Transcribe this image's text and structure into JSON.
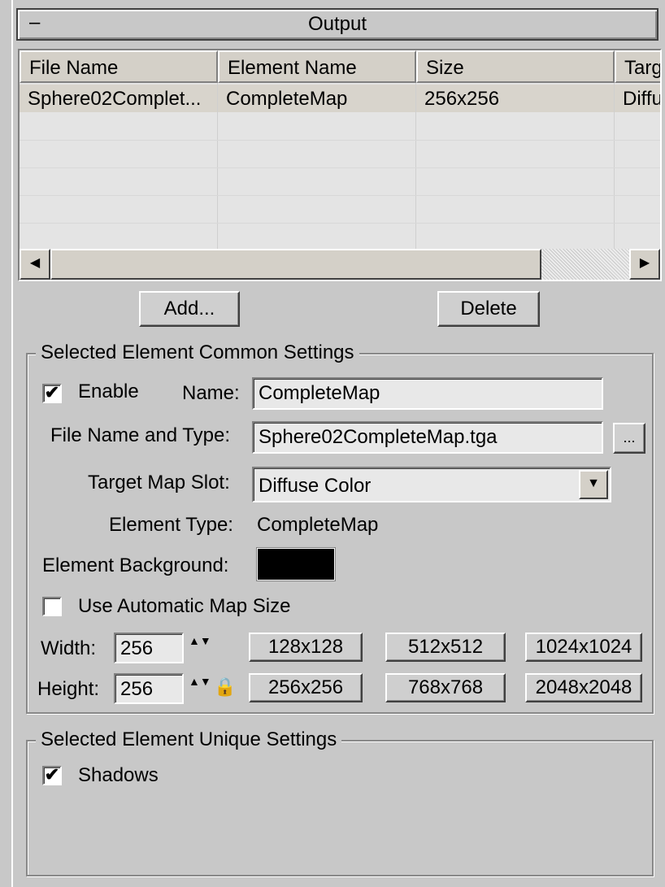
{
  "rollout": {
    "toggle": "–",
    "title": "Output"
  },
  "list": {
    "columns": [
      "File Name",
      "Element Name",
      "Size",
      "Targ"
    ],
    "rows": [
      {
        "file_name": "Sphere02Complet...",
        "element_name": "CompleteMap",
        "size": "256x256",
        "target": "Diffu"
      }
    ],
    "scroll_left": "◀",
    "scroll_right": "▶"
  },
  "buttons": {
    "add": "Add...",
    "delete": "Delete"
  },
  "common": {
    "title": "Selected Element Common Settings",
    "enable_label": "Enable",
    "enable_checked": "✔",
    "name_label": "Name:",
    "name_value": "CompleteMap",
    "file_label": "File Name and Type:",
    "file_value": "Sphere02CompleteMap.tga",
    "browse": "...",
    "slot_label": "Target Map Slot:",
    "slot_value": "Diffuse Color",
    "slot_arrow": "▼",
    "type_label": "Element Type:",
    "type_value": "CompleteMap",
    "bg_label": "Element Background:",
    "bg_color": "#000000",
    "auto_label": "Use Automatic Map Size",
    "width_label": "Width:",
    "width_value": "256",
    "height_label": "Height:",
    "height_value": "256",
    "spinner_glyph": "▲▼",
    "lock_icon": "🔒",
    "sizes": [
      "128x128",
      "512x512",
      "1024x1024",
      "256x256",
      "768x768",
      "2048x2048"
    ]
  },
  "unique": {
    "title": "Selected Element Unique Settings",
    "shadows_label": "Shadows",
    "shadows_checked": "✔"
  }
}
